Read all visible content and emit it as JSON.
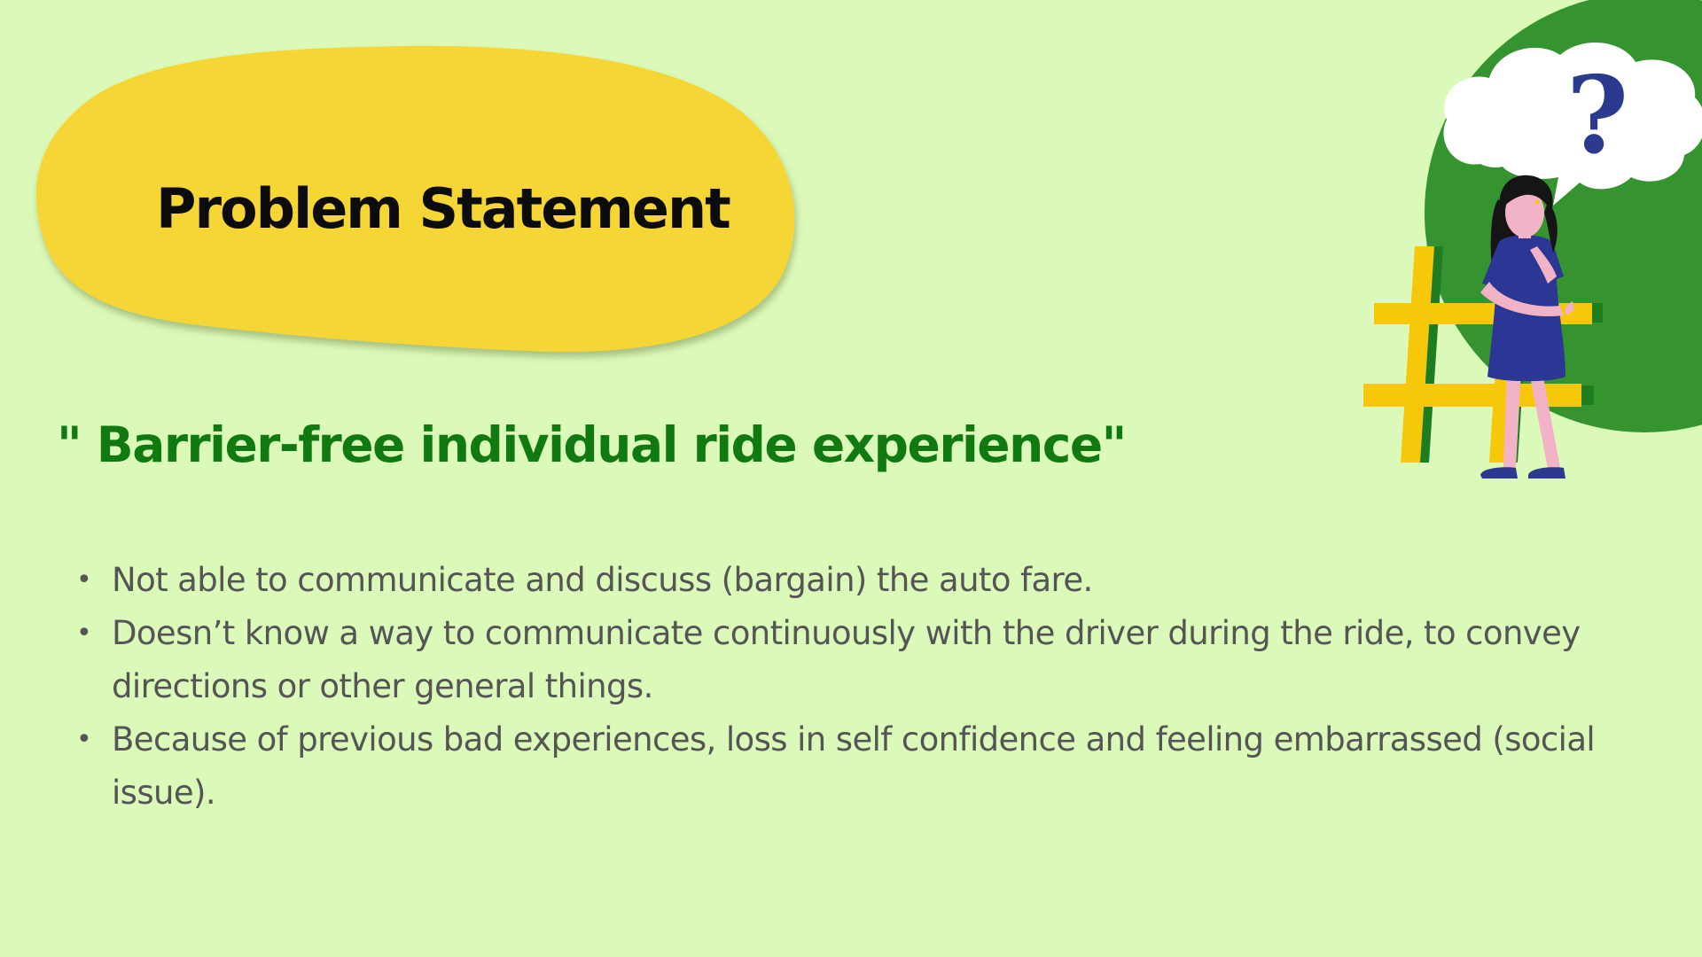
{
  "title": "Problem Statement",
  "subtitle": "\" Barrier-free individual ride experience\"",
  "bullets": [
    "Not able to communicate and discuss (bargain) the auto fare.",
    "Doesn’t know a way to communicate continuously with the driver during the ride, to convey directions or other general things.",
    "Because of previous bad experiences, loss in self confidence and feeling embarrassed (social issue)."
  ],
  "illustration": {
    "icon": "thinking-woman-hashtag-illustration",
    "question_mark": "?"
  },
  "colors": {
    "background": "#dbf9b8",
    "title_blob": "#f5d636",
    "subtitle": "#107a10",
    "body_text": "#555555",
    "circle": "#359430",
    "hashtag": "#f7c709"
  }
}
